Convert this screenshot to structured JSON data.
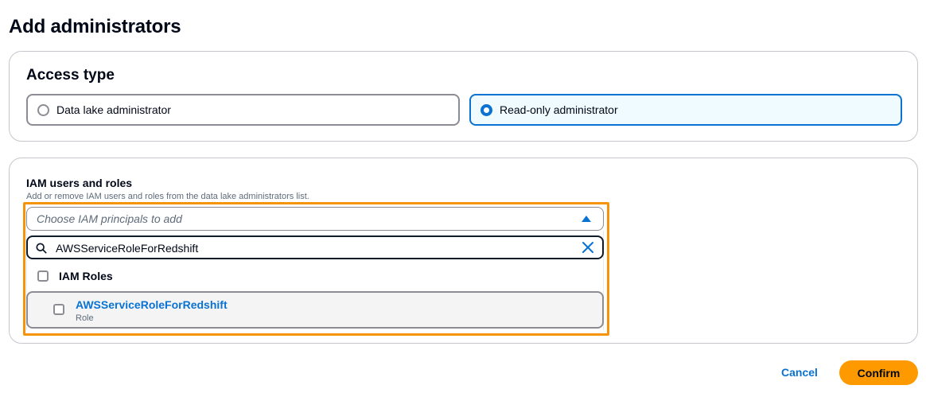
{
  "page": {
    "title": "Add administrators"
  },
  "access_type": {
    "title": "Access type",
    "options": [
      {
        "label": "Data lake administrator",
        "selected": false
      },
      {
        "label": "Read-only administrator",
        "selected": true
      }
    ]
  },
  "iam": {
    "label": "IAM users and roles",
    "description": "Add or remove IAM users and roles from the data lake administrators list.",
    "select_placeholder": "Choose IAM principals to add",
    "search_value": "AWSServiceRoleForRedshift",
    "group_label": "IAM Roles",
    "option": {
      "title": "AWSServiceRoleForRedshift",
      "subtitle": "Role"
    }
  },
  "footer": {
    "cancel_label": "Cancel",
    "confirm_label": "Confirm"
  },
  "colors": {
    "accent": "#0972d3",
    "highlight": "#f5930b",
    "primary_button": "#ff9900"
  },
  "icons": {
    "search": "search-icon",
    "clear": "close-icon",
    "caret": "caret-up-icon"
  }
}
